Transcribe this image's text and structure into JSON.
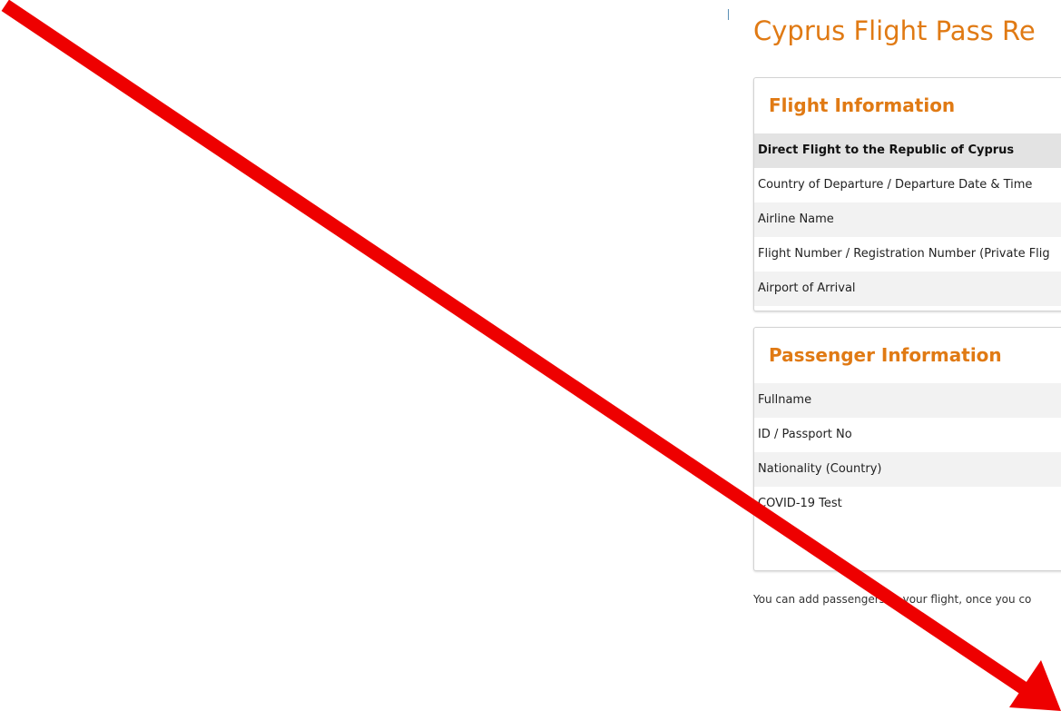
{
  "page_title": "Cyprus Flight Pass Re",
  "flight_section": {
    "title": "Flight Information",
    "rows": [
      "Direct Flight to the Republic of Cyprus",
      "Country of Departure / Departure Date & Time",
      "Airline Name",
      "Flight Number / Registration Number (Private Flig",
      "Airport of Arrival"
    ]
  },
  "passenger_section": {
    "title": "Passenger Information",
    "rows": [
      "Fullname",
      "ID / Passport No",
      "Nationality (Country)",
      "COVID-19 Test"
    ]
  },
  "note": "You can add passengers to your flight, once you co",
  "colors": {
    "accent": "#e07a14",
    "arrow": "#ee0000"
  }
}
